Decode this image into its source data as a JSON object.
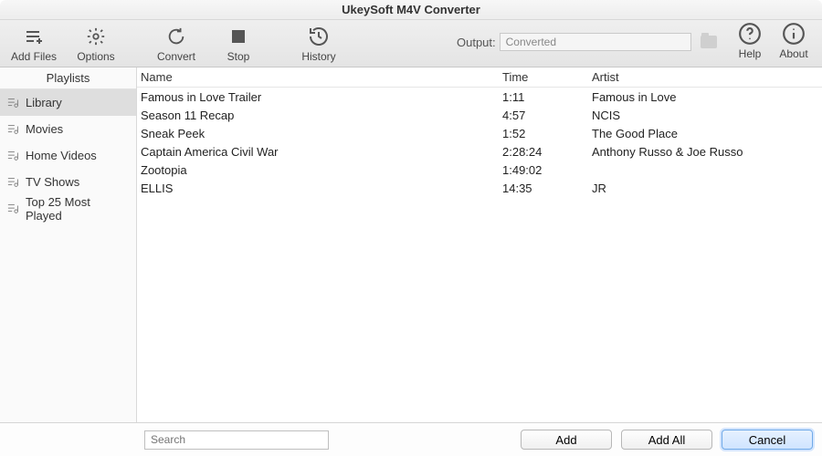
{
  "app_title": "UkeySoft M4V Converter",
  "toolbar": {
    "add_files": "Add Files",
    "options": "Options",
    "convert": "Convert",
    "stop": "Stop",
    "history": "History",
    "help": "Help",
    "about": "About"
  },
  "output": {
    "label": "Output:",
    "value": "Converted"
  },
  "sidebar": {
    "header": "Playlists",
    "items": [
      {
        "label": "Library",
        "selected": true
      },
      {
        "label": "Movies",
        "selected": false
      },
      {
        "label": "Home Videos",
        "selected": false
      },
      {
        "label": "TV Shows",
        "selected": false
      },
      {
        "label": "Top 25 Most Played",
        "selected": false
      }
    ]
  },
  "table": {
    "columns": {
      "name": "Name",
      "time": "Time",
      "artist": "Artist"
    },
    "rows": [
      {
        "name": "Famous in Love  Trailer",
        "time": "1:11",
        "artist": "Famous in Love"
      },
      {
        "name": "Season 11 Recap",
        "time": "4:57",
        "artist": "NCIS"
      },
      {
        "name": "Sneak Peek",
        "time": "1:52",
        "artist": "The Good Place"
      },
      {
        "name": "Captain America  Civil War",
        "time": "2:28:24",
        "artist": "Anthony Russo & Joe Russo"
      },
      {
        "name": "Zootopia",
        "time": "1:49:02",
        "artist": ""
      },
      {
        "name": "ELLIS",
        "time": "14:35",
        "artist": "JR"
      }
    ]
  },
  "search": {
    "placeholder": "Search"
  },
  "buttons": {
    "add": "Add",
    "add_all": "Add All",
    "cancel": "Cancel"
  }
}
